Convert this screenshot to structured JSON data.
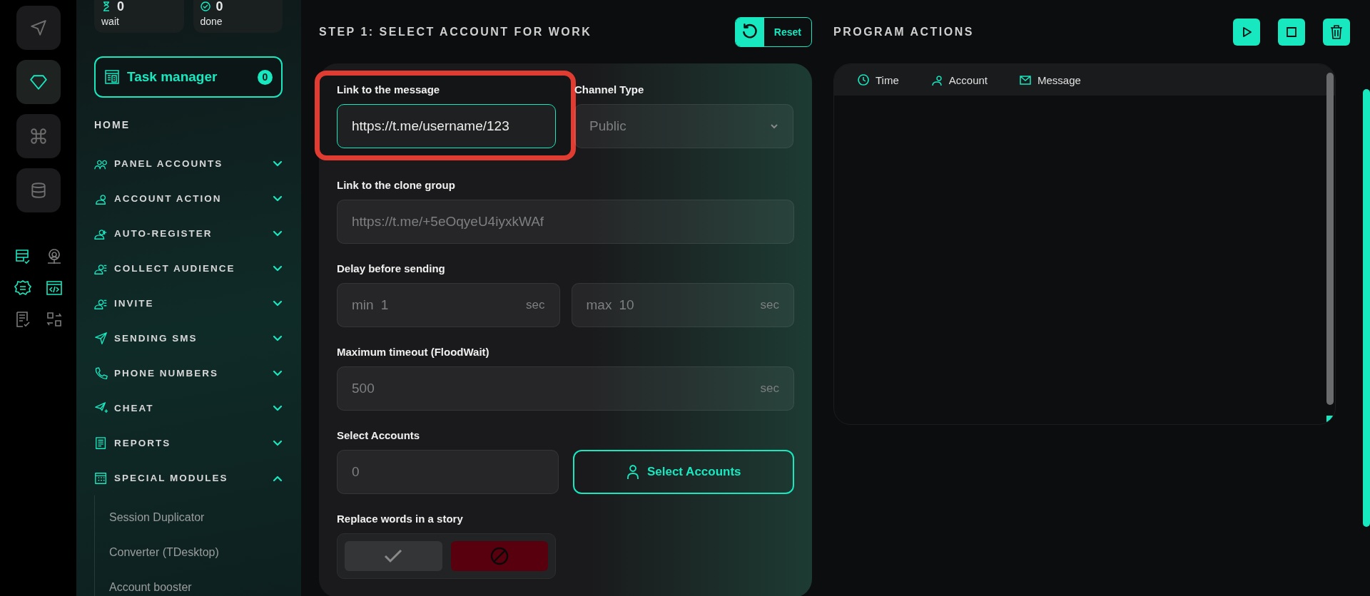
{
  "rail": [
    {
      "selected": false
    },
    {
      "selected": true
    },
    {
      "selected": false
    },
    {
      "selected": false
    }
  ],
  "rail_tools": [
    {
      "active": true
    },
    {
      "active": false
    },
    {
      "active": true
    },
    {
      "active": true
    },
    {
      "active": false
    },
    {
      "active": false
    }
  ],
  "stats": [
    {
      "value": "0",
      "label": "wait"
    },
    {
      "value": "0",
      "label": "done"
    }
  ],
  "task_manager": {
    "label": "Task manager",
    "count": "0"
  },
  "sidebar": {
    "home": "HOME",
    "menu": [
      {
        "label": "PANEL ACCOUNTS",
        "expanded": false
      },
      {
        "label": "ACCOUNT ACTION",
        "expanded": false
      },
      {
        "label": "AUTO-REGISTER",
        "expanded": false
      },
      {
        "label": "COLLECT AUDIENCE",
        "expanded": false
      },
      {
        "label": "INVITE",
        "expanded": false
      },
      {
        "label": "SENDING SMS",
        "expanded": false
      },
      {
        "label": "PHONE NUMBERS",
        "expanded": false
      },
      {
        "label": "CHEAT",
        "expanded": false
      },
      {
        "label": "REPORTS",
        "expanded": false
      },
      {
        "label": "SPECIAL MODULES",
        "expanded": true,
        "children": [
          "Session Duplicator",
          "Converter (TDesktop)",
          "Account booster"
        ]
      }
    ]
  },
  "step": {
    "title": "STEP 1: SELECT ACCOUNT FOR WORK",
    "reset": "Reset"
  },
  "form": {
    "message_link": {
      "label": "Link to the message",
      "value": "https://t.me/username/123",
      "highlighted": true
    },
    "channel_type": {
      "label": "Channel Type",
      "value": "Public",
      "disabled": true
    },
    "clone_group": {
      "label": "Link to the clone group",
      "placeholder": "https://t.me/+5eOqyeU4iyxkWAf"
    },
    "delay": {
      "label": "Delay before sending",
      "fields": [
        {
          "prefix": "min",
          "placeholder": "1",
          "unit": "sec"
        },
        {
          "prefix": "max",
          "placeholder": "10",
          "unit": "sec"
        }
      ]
    },
    "timeout": {
      "label": "Maximum timeout (FloodWait)",
      "placeholder": "500",
      "unit": "sec"
    },
    "accounts": {
      "label": "Select Accounts",
      "placeholder": "0",
      "button": "Select Accounts"
    },
    "replace_words": {
      "label": "Replace words in a story",
      "options": [
        {
          "kind": "yes",
          "selected": false
        },
        {
          "kind": "no",
          "selected": true
        }
      ]
    }
  },
  "program_actions": {
    "title": "PROGRAM ACTIONS",
    "columns": [
      "Time",
      "Account",
      "Message"
    ]
  }
}
